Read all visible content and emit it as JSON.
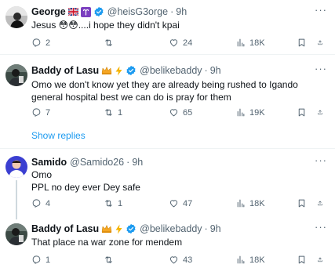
{
  "tweets": [
    {
      "name": "George",
      "emojis": [
        "flag-uk-icon",
        "aries-icon"
      ],
      "verified": true,
      "handle": "@heisG3orge",
      "dot": "·",
      "time": "9h",
      "text": "Jesus 😳😳....i hope they didn't kpai",
      "replies": "2",
      "retweets": "",
      "likes": "24",
      "views": "18K"
    },
    {
      "name": "Baddy of Lasu",
      "emojis": [
        "crown-icon",
        "lightning-icon"
      ],
      "verified": true,
      "handle": "@belikebaddy",
      "dot": "·",
      "time": "9h",
      "text": "Omo we don't know yet they are already being rushed to Igando general hospital best we can do is pray for them",
      "replies": "7",
      "retweets": "1",
      "likes": "65",
      "views": "19K"
    },
    {
      "name": "Samido",
      "emojis": [],
      "verified": false,
      "handle": "@Samido26",
      "dot": "·",
      "time": "9h",
      "text_lines": [
        "Omo",
        "PPL no dey ever Dey safe"
      ],
      "replies": "4",
      "retweets": "1",
      "likes": "47",
      "views": "18K"
    },
    {
      "name": "Baddy of Lasu",
      "emojis": [
        "crown-icon",
        "lightning-icon"
      ],
      "verified": true,
      "handle": "@belikebaddy",
      "dot": "·",
      "time": "9h",
      "text": "That place na war zone for mendem",
      "replies": "1",
      "retweets": "",
      "likes": "43",
      "views": "18K"
    }
  ],
  "show_replies": "Show replies",
  "more_label": "···",
  "colors": {
    "text": "#0f1419",
    "secondary": "#536471",
    "link": "#1d9bf0",
    "verified": "#1d9bf0",
    "divider": "#eff3f4"
  }
}
